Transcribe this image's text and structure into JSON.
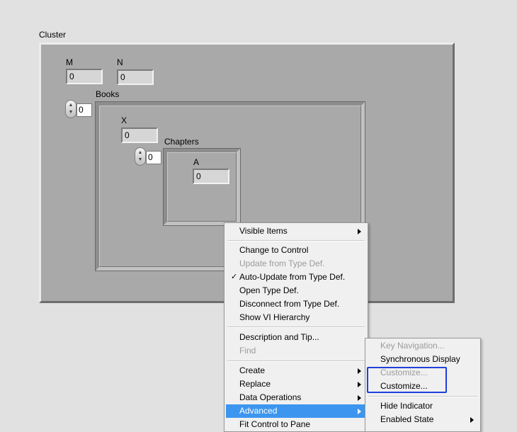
{
  "cluster": {
    "label": "Cluster",
    "m": {
      "label": "M",
      "value": "0"
    },
    "n": {
      "label": "N",
      "value": "0"
    },
    "books": {
      "label": "Books",
      "index": "0",
      "x": {
        "label": "X",
        "value": "0"
      },
      "chapters": {
        "label": "Chapters",
        "index": "0",
        "a": {
          "label": "A",
          "value": "0"
        }
      }
    }
  },
  "context_menu": {
    "items": [
      {
        "label": "Visible Items",
        "submenu": true
      },
      {
        "label": "Change to Control"
      },
      {
        "label": "Update from Type Def.",
        "disabled": true
      },
      {
        "label": "Auto-Update from Type Def.",
        "checked": true
      },
      {
        "label": "Open Type Def."
      },
      {
        "label": "Disconnect from Type Def."
      },
      {
        "label": "Show VI Hierarchy"
      },
      {
        "label": "Description and Tip..."
      },
      {
        "label": "Find",
        "disabled": true
      },
      {
        "label": "Create",
        "submenu": true
      },
      {
        "label": "Replace",
        "submenu": true
      },
      {
        "label": "Data Operations",
        "submenu": true
      },
      {
        "label": "Advanced",
        "submenu": true,
        "highlighted": true
      },
      {
        "label": "Fit Control to Pane"
      }
    ]
  },
  "advanced_submenu": {
    "items": [
      {
        "label": "Key Navigation...",
        "disabled": true
      },
      {
        "label": "Synchronous Display"
      },
      {
        "label": "Customize...",
        "disabled": true
      },
      {
        "label": "Customize..."
      },
      {
        "label": "Hide Indicator"
      },
      {
        "label": "Enabled State",
        "submenu": true
      }
    ]
  },
  "colors": {
    "menu_highlight": "#3c96ef",
    "focus_box": "#1f3fdc",
    "cluster_bg": "#a9a9a9"
  }
}
